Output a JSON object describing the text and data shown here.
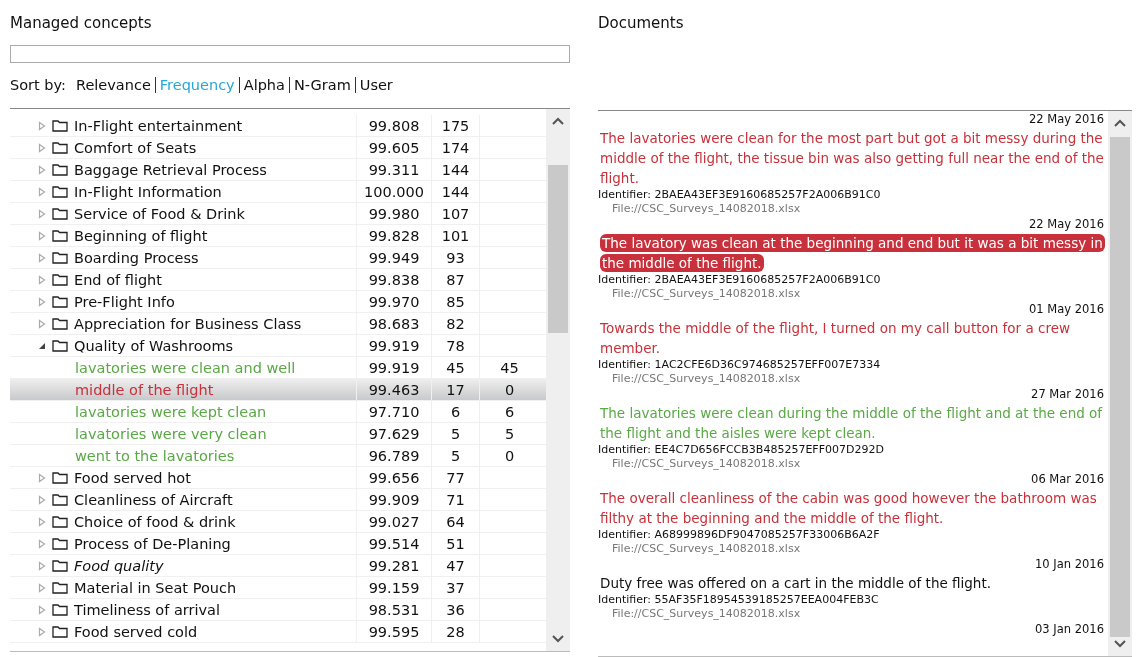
{
  "concepts": {
    "title": "Managed concepts",
    "sort_label": "Sort by:",
    "sort_options": [
      {
        "label": "Relevance",
        "selected": false
      },
      {
        "label": "Frequency",
        "selected": true
      },
      {
        "label": "Alpha",
        "selected": false
      },
      {
        "label": "N-Gram",
        "selected": false
      },
      {
        "label": "User",
        "selected": false
      }
    ],
    "rows": [
      {
        "kind": "concept",
        "label": "In-Flight entertainment",
        "score": "99.808",
        "count": "175",
        "expanded": false,
        "italic": false,
        "selected": false
      },
      {
        "kind": "concept",
        "label": "Comfort of Seats",
        "score": "99.605",
        "count": "174",
        "expanded": false,
        "italic": false,
        "selected": false
      },
      {
        "kind": "concept",
        "label": "Baggage Retrieval Process",
        "score": "99.311",
        "count": "144",
        "expanded": false,
        "italic": false,
        "selected": false
      },
      {
        "kind": "concept",
        "label": "In-Flight Information",
        "score": "100.000",
        "count": "144",
        "expanded": false,
        "italic": false,
        "selected": false
      },
      {
        "kind": "concept",
        "label": "Service of Food & Drink",
        "score": "99.980",
        "count": "107",
        "expanded": false,
        "italic": false,
        "selected": false
      },
      {
        "kind": "concept",
        "label": "Beginning of flight",
        "score": "99.828",
        "count": "101",
        "expanded": false,
        "italic": false,
        "selected": false
      },
      {
        "kind": "concept",
        "label": "Boarding Process",
        "score": "99.949",
        "count": "93",
        "expanded": false,
        "italic": false,
        "selected": false
      },
      {
        "kind": "concept",
        "label": "End of flight",
        "score": "99.838",
        "count": "87",
        "expanded": false,
        "italic": false,
        "selected": false
      },
      {
        "kind": "concept",
        "label": "Pre-Flight Info",
        "score": "99.970",
        "count": "85",
        "expanded": false,
        "italic": false,
        "selected": false
      },
      {
        "kind": "concept",
        "label": "Appreciation for Business Class",
        "score": "98.683",
        "count": "82",
        "expanded": false,
        "italic": false,
        "selected": false
      },
      {
        "kind": "concept",
        "label": "Quality of Washrooms",
        "score": "99.919",
        "count": "78",
        "expanded": true,
        "italic": false,
        "selected": false,
        "children": [
          {
            "kind": "phrase",
            "label": "lavatories were clean and well",
            "score": "99.919",
            "count": "45",
            "column_3": "45",
            "color": "#5aa846",
            "selected": false
          },
          {
            "kind": "phrase",
            "label": "middle of the flight",
            "score": "99.463",
            "count": "17",
            "column_3": "0",
            "color": "#c8313b",
            "selected": true
          },
          {
            "kind": "phrase",
            "label": "lavatories were kept clean",
            "score": "97.710",
            "count": "6",
            "column_3": "6",
            "color": "#5aa846",
            "selected": false
          },
          {
            "kind": "phrase",
            "label": "lavatories were very clean",
            "score": "97.629",
            "count": "5",
            "column_3": "5",
            "color": "#5aa846",
            "selected": false
          },
          {
            "kind": "phrase",
            "label": "went to the lavatories",
            "score": "96.789",
            "count": "5",
            "column_3": "0",
            "color": "#5aa846",
            "selected": false
          }
        ]
      },
      {
        "kind": "concept",
        "label": "Food served hot",
        "score": "99.656",
        "count": "77",
        "expanded": false,
        "italic": false,
        "selected": false
      },
      {
        "kind": "concept",
        "label": "Cleanliness of Aircraft",
        "score": "99.909",
        "count": "71",
        "expanded": false,
        "italic": false,
        "selected": false
      },
      {
        "kind": "concept",
        "label": "Choice of food & drink",
        "score": "99.027",
        "count": "64",
        "expanded": false,
        "italic": false,
        "selected": false
      },
      {
        "kind": "concept",
        "label": "Process of De-Planing",
        "score": "99.514",
        "count": "51",
        "expanded": false,
        "italic": false,
        "selected": false
      },
      {
        "kind": "concept",
        "label": "Food quality",
        "score": "99.281",
        "count": "47",
        "expanded": false,
        "italic": true,
        "selected": false
      },
      {
        "kind": "concept",
        "label": "Material in Seat Pouch",
        "score": "99.159",
        "count": "37",
        "expanded": false,
        "italic": false,
        "selected": false
      },
      {
        "kind": "concept",
        "label": "Timeliness of arrival",
        "score": "98.531",
        "count": "36",
        "expanded": false,
        "italic": false,
        "selected": false
      },
      {
        "kind": "concept",
        "label": "Food served cold",
        "score": "99.595",
        "count": "28",
        "expanded": false,
        "italic": false,
        "selected": false
      }
    ]
  },
  "documents": {
    "title": "Documents",
    "items": [
      {
        "date": "22 May 2016",
        "text": "The lavatories were clean for the most part but got a bit messy during the middle of the flight, the tissue bin was also getting full near the end of the flight.",
        "color": "#c8313b",
        "selected": false,
        "identifier": "Identifier: 2BAEA43EF3E9160685257F2A006B91C0",
        "file": "File://CSC_Surveys_14082018.xlsx"
      },
      {
        "date": "22 May 2016",
        "text": "The lavatory was clean at the beginning and end but it was a bit messy in the middle of the flight.",
        "color": "#c8313b",
        "selected": true,
        "identifier": "Identifier: 2BAEA43EF3E9160685257F2A006B91C0",
        "file": "File://CSC_Surveys_14082018.xlsx"
      },
      {
        "date": "01 May 2016",
        "text": "Towards the middle of the flight, I turned on my call button for a crew member.",
        "color": "#c8313b",
        "selected": false,
        "identifier": "Identifier: 1AC2CFE6D36C974685257EFF007E7334",
        "file": "File://CSC_Surveys_14082018.xlsx"
      },
      {
        "date": "27 Mar 2016",
        "text": "The lavatories were clean during the middle of the flight and at the end of the flight and the aisles were kept clean.",
        "color": "#5aa846",
        "selected": false,
        "identifier": "Identifier: EE4C7D656FCCB3B485257EFF007D292D",
        "file": "File://CSC_Surveys_14082018.xlsx"
      },
      {
        "date": "06 Mar 2016",
        "text": "The overall cleanliness of the cabin was good however the bathroom was filthy at the beginning and the middle of the flight.",
        "color": "#c8313b",
        "selected": false,
        "identifier": "Identifier: A68999896DF9047085257F33006B6A2F",
        "file": "File://CSC_Surveys_14082018.xlsx"
      },
      {
        "date": "10 Jan 2016",
        "text": "Duty free was offered on a cart in the middle of the flight.",
        "color": "#111111",
        "selected": false,
        "identifier": "Identifier: 55AF35F18954539185257EEA004FEB3C",
        "file": "File://CSC_Surveys_14082018.xlsx"
      },
      {
        "date": "03 Jan 2016"
      }
    ]
  }
}
